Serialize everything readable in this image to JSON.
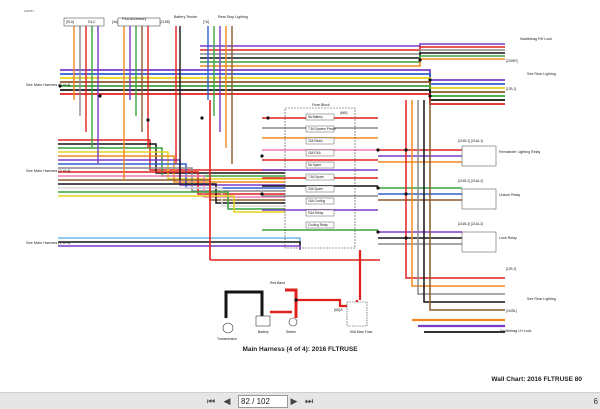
{
  "page": {
    "doc_id": "e09767",
    "title": "Main Harness (4 of 4): 2016 FLTRUSE",
    "footer": "Wall Chart: 2016 FLTRUSE   80"
  },
  "connectors_top": [
    {
      "label": "[91A]",
      "name": "DLC"
    },
    {
      "label": "[4A]",
      "name": "P&A Accessory"
    },
    {
      "label": "[215B]",
      "name": "Battery Tender"
    },
    {
      "label": "[7A]",
      "name": "Rear Stop Lighting"
    }
  ],
  "left_labels": [
    {
      "name": "See Main Harness (2 of 4)"
    },
    {
      "name": "See Main Harness (3 of 4)"
    },
    {
      "name": "See Main Harness (1 of 4)"
    }
  ],
  "right_labels": [
    {
      "name": "Saddlebag RH Lock",
      "code": "[210BR]"
    },
    {
      "name": "See Rear Lighting",
      "code": "[12B-1]"
    },
    {
      "name": "Remainder Lighting Relay",
      "code": "[214B-1] [214A-1]"
    },
    {
      "name": "Unlock Relay",
      "code": "[214B-2] [214A-2]"
    },
    {
      "name": "Lock Relay",
      "code": "[214B-3] [214A-3]"
    },
    {
      "name": "See Rear Lighting",
      "code": "[12B-2]"
    },
    {
      "name": "Saddlebag LH Lock",
      "code": "[210BL]"
    }
  ],
  "fuse_block": {
    "name": "Fuse Block",
    "code": "[64B]",
    "fuses": [
      "5A Battery",
      "7.5A System Power",
      "20A Radio",
      "15A P&A",
      "5A Spare",
      "7.5A Spare",
      "20A Spare",
      "15A Cooling",
      "P&A Relay",
      "Cooling Relay"
    ]
  },
  "bottom_parts": [
    {
      "name": "Red Band"
    },
    {
      "name": "Transmission"
    },
    {
      "name": "Battery"
    },
    {
      "name": "Starter"
    },
    {
      "name": "50A Maxi Fuse"
    },
    {
      "name": "[68] A",
      "code": "[68]"
    }
  ],
  "colors": {
    "red": "#e0201c",
    "orange": "#f08a1e",
    "yellow": "#e6d21e",
    "green": "#3aa43a",
    "blue": "#2f5fd0",
    "violet": "#7a3cc8",
    "brown": "#8a5a2b",
    "gray": "#8a8a8a",
    "black": "#151515",
    "pink": "#f07ab4",
    "white": "#d8d8d8",
    "lightblue": "#6fb8ea"
  },
  "toolbar": {
    "first_icon": "first-page-icon",
    "prev_icon": "prev-page-icon",
    "page_value": "82 / 102",
    "next_icon": "next-page-icon",
    "last_icon": "last-page-icon",
    "zoom_text": "6"
  }
}
